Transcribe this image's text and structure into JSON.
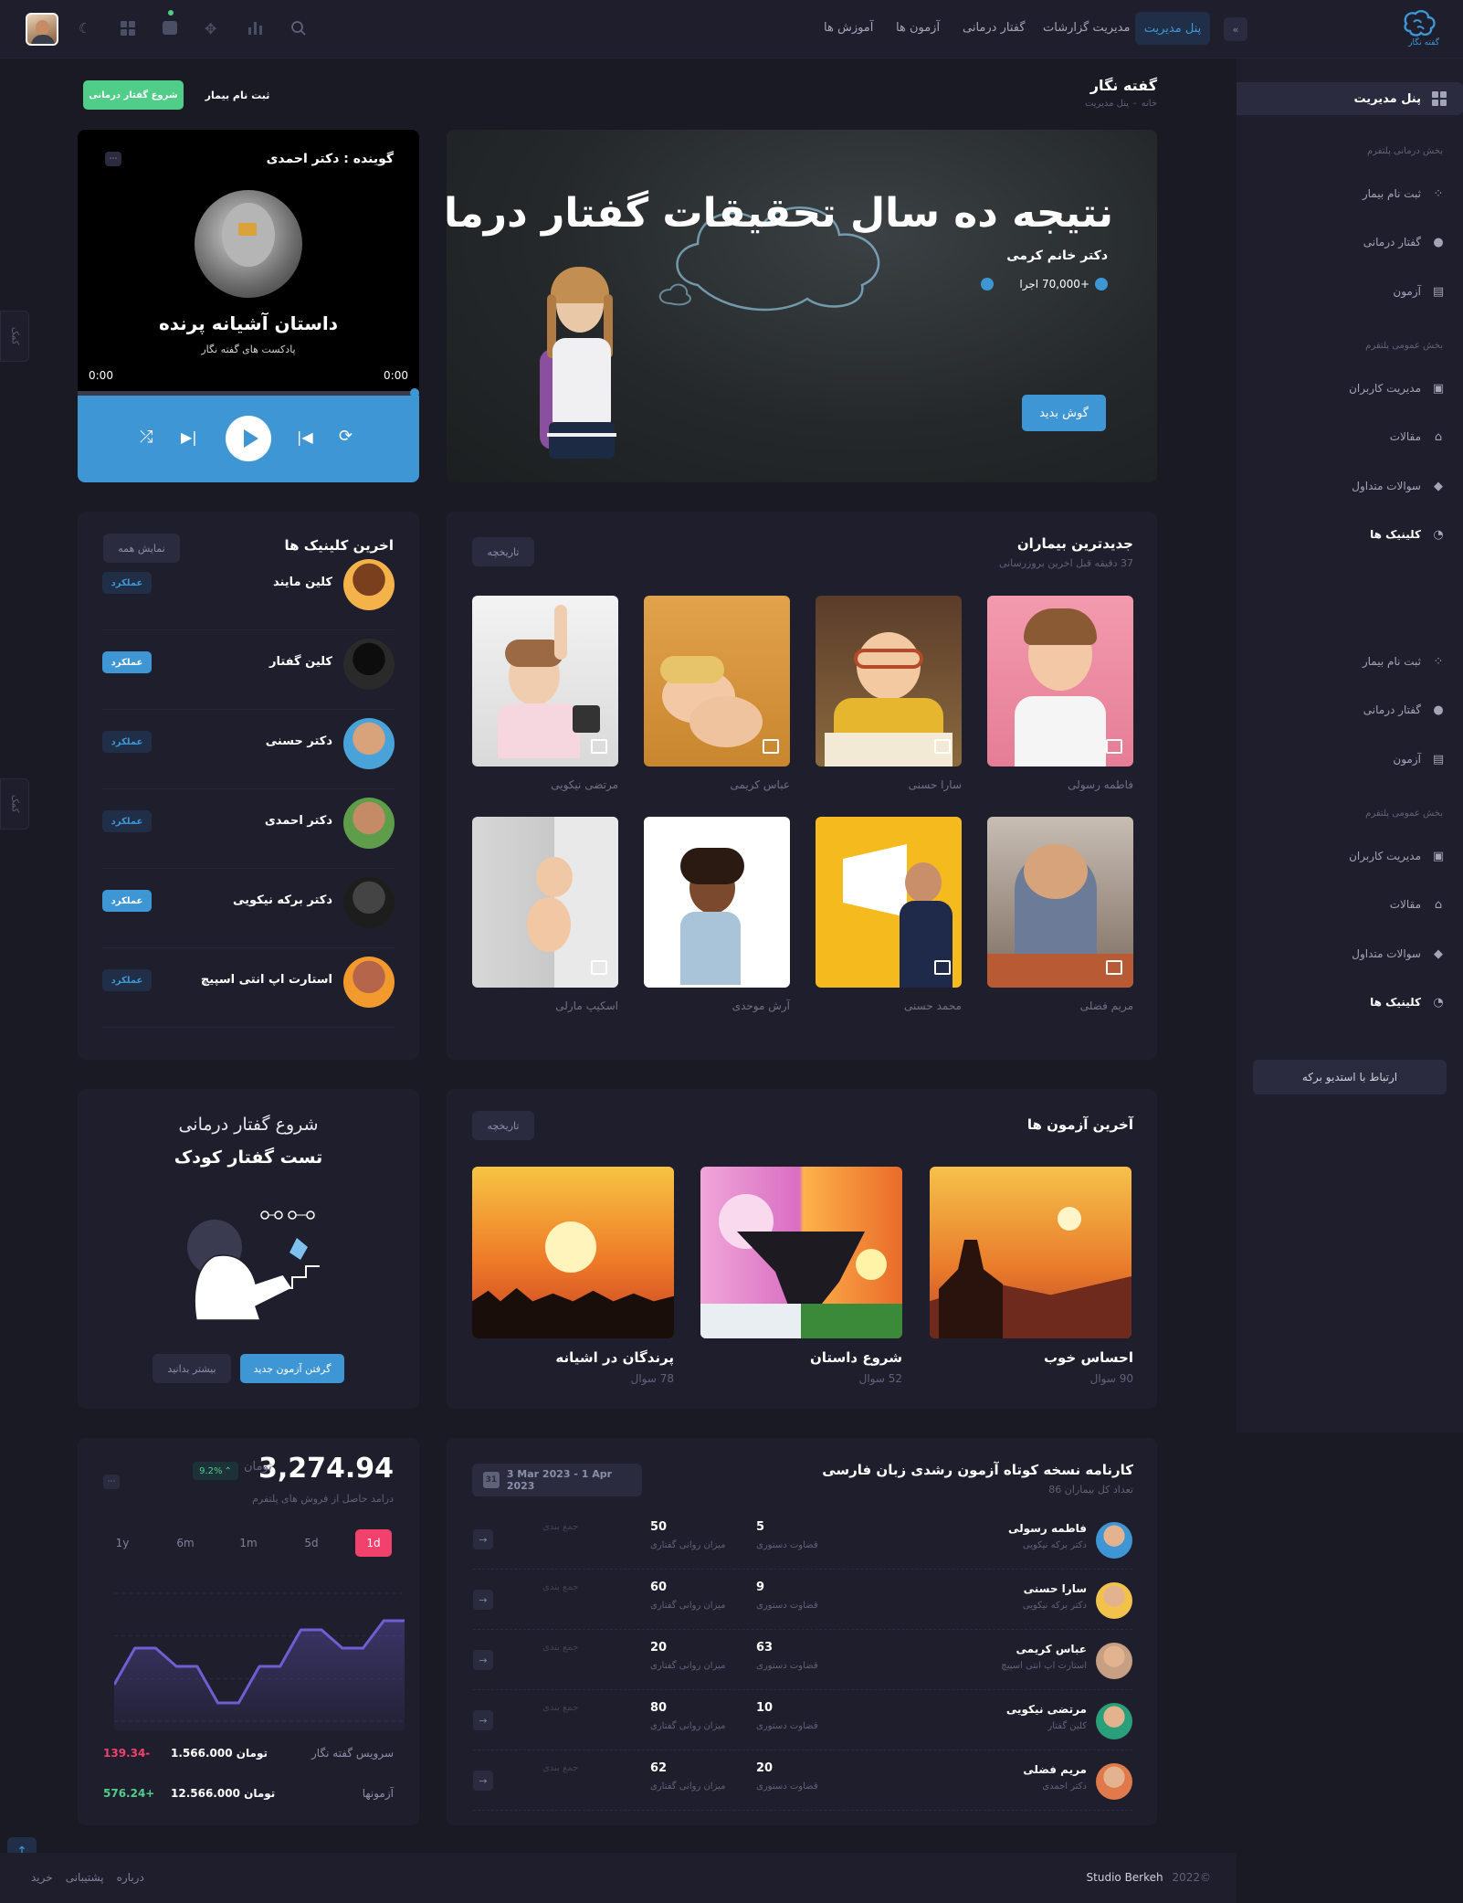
{
  "app": {
    "logo_text": "گفته نگار"
  },
  "nav": {
    "items": [
      {
        "label": "پنل مدیریت",
        "active": true
      },
      {
        "label": "مدیریت گزارشات"
      },
      {
        "label": "گفتار درمانی"
      },
      {
        "label": "آزمون ها"
      },
      {
        "label": "آموزش ها"
      }
    ]
  },
  "page": {
    "title": "گفته نگار",
    "breadcrumb_home": "خانه",
    "breadcrumb_sep": "-",
    "breadcrumb_current": "پنل مدیریت"
  },
  "header_actions": {
    "register_patient": "ثبت نام بیمار",
    "start_therapy": "شروع گفتار درمانی"
  },
  "sidebar": {
    "top_item": "پنل مدیریت",
    "section1": "بخش درمانی پلتفرم",
    "items1": [
      "ثبت نام بیمار",
      "گفتار درمانی",
      "آزمون"
    ],
    "section2": "بخش عمومی پلتفرم",
    "items2": [
      "مدیریت کاربران",
      "مقالات",
      "سوالات متداول",
      "کلینیک ها"
    ],
    "items3": [
      "ثبت نام بیمار",
      "گفتار درمانی",
      "آزمون"
    ],
    "section3": "بخش عمومی پلتفرم",
    "items4": [
      "مدیریت کاربران",
      "مقالات",
      "سوالات متداول",
      "کلینیک ها"
    ],
    "footer_button": "ارتباط با استدیو برکه"
  },
  "side_tabs": [
    "کمک",
    "کمک"
  ],
  "hero": {
    "title": "نتیجه ده سال تحقیقات گفتار درمانی",
    "author": "دکتر خانم کرمی",
    "plays": "+70,000 اجرا",
    "listen_button": "گوش بدید"
  },
  "player": {
    "speaker": "گوینده : دکتر احمدی",
    "title": "داستان آشیانه پرنده",
    "subtitle": "پادکست های گفته نگار",
    "time_start": "0:00",
    "time_end": "0:00",
    "progress": 0
  },
  "patients": {
    "title": "جدیدترین بیماران",
    "subtitle": "37 دقیقه قبل اخرین بروزرسانی",
    "history_button": "تاریخچه",
    "names": [
      "فاطمه رسولی",
      "سارا حسنی",
      "عباس کریمی",
      "مرتضی نیکویی",
      "مریم فضلی",
      "محمد حسنی",
      "آرش موحدی",
      "اسکیپ مارلی"
    ]
  },
  "clinics": {
    "title": "اخرین کلینیک ها",
    "show_all": "نمایش همه",
    "items": [
      {
        "name": "کلین مایند",
        "badge": "عملکرد",
        "highlight": false
      },
      {
        "name": "کلین گفتار",
        "badge": "عملکرد",
        "highlight": true
      },
      {
        "name": "دکتر حسنی",
        "badge": "عملکرد",
        "highlight": false
      },
      {
        "name": "دکتر احمدی",
        "badge": "عملکرد",
        "highlight": false
      },
      {
        "name": "دکتر برکه نیکویی",
        "badge": "عملکرد",
        "highlight": true
      },
      {
        "name": "استارت اپ انتی اسپیچ",
        "badge": "عملکرد",
        "highlight": false
      }
    ]
  },
  "tests": {
    "title": "آخرین آزمون ها",
    "history_button": "تاریخچه",
    "items": [
      {
        "name": "احساس خوب",
        "count": "90 سوال"
      },
      {
        "name": "شروع داستان",
        "count": "52 سوال"
      },
      {
        "name": "پرندگان در اشیانه",
        "count": "78 سوال"
      }
    ]
  },
  "promo": {
    "line1": "شروع گفتار درمانی",
    "line2": "تست گفتار کودک",
    "primary_button": "گرفتن آزمون جدید",
    "secondary_button": "بیشتر بدانید"
  },
  "report": {
    "title": "کارنامه نسخه کوتاه آزمون رشدی زبان فارسی",
    "subtitle": "تعداد کل بیماران 86",
    "date_range": "3 Mar 2023 - 1 Apr 2023",
    "calendar_day": "31",
    "label_grammar": "قضاوت دستوری",
    "label_fluency": "میزان روانی گفتاری",
    "label_summary": "جمع بندی",
    "rows": [
      {
        "name": "فاطمه رسولی",
        "doctor": "دکتر برکه نیکویی",
        "grammar": "5",
        "fluency": "50"
      },
      {
        "name": "سارا حسنی",
        "doctor": "دکتر برکه نیکویی",
        "grammar": "9",
        "fluency": "60"
      },
      {
        "name": "عباس کریمی",
        "doctor": "استارت اپ انتی اسپیچ",
        "grammar": "63",
        "fluency": "20"
      },
      {
        "name": "مرتضی نیکویی",
        "doctor": "کلین گفتار",
        "grammar": "10",
        "fluency": "80"
      },
      {
        "name": "مریم فضلی",
        "doctor": "دکتر احمدی",
        "grammar": "20",
        "fluency": "62"
      }
    ]
  },
  "revenue": {
    "amount": "3,274.94",
    "currency": "تومان",
    "change": "9.2%",
    "subtitle": "درامد حاصل از فروش های پلتفرم",
    "periods": [
      "1d",
      "5d",
      "1m",
      "6m",
      "1y"
    ],
    "active_period": "1d",
    "rows": [
      {
        "label": "سرویس گفته نگار",
        "value": "1.566.000",
        "unit": "تومان",
        "delta": "139.34-",
        "positive": false
      },
      {
        "label": "آزمونها",
        "value": "12.566.000",
        "unit": "تومان",
        "delta": "576.24+",
        "positive": true
      }
    ]
  },
  "chart_data": {
    "type": "area",
    "values": [
      20,
      40,
      40,
      30,
      30,
      10,
      10,
      30,
      30,
      50,
      50,
      40,
      40,
      55,
      55
    ],
    "ylim": [
      0,
      70
    ],
    "grid": true,
    "color": "#6f5ed1"
  },
  "footer": {
    "year": "2022©",
    "brand": "Studio Berkeh",
    "links": [
      "درباره",
      "پشتیبانی",
      "خرید"
    ]
  },
  "colors": {
    "primary": "#3e97d4",
    "success": "#50cd89",
    "danger": "#f1416c",
    "bg": "#1a1a25",
    "card": "#1e1e2d"
  }
}
